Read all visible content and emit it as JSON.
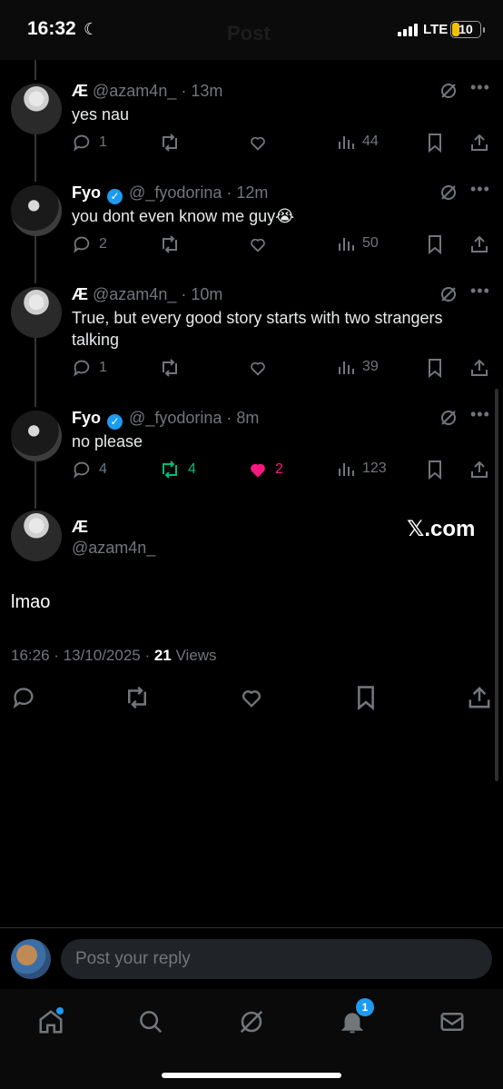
{
  "status_bar": {
    "time": "16:32",
    "network": "LTE",
    "battery": "10"
  },
  "header": {
    "title": "Post"
  },
  "replies": [
    {
      "name": "Æ",
      "verified": false,
      "handle": "@azam4n_",
      "time": "13m",
      "text": "yes nau",
      "replies": "1",
      "reposts": "",
      "likes": "",
      "views": "44",
      "avatar": "ae"
    },
    {
      "name": "Fyo",
      "verified": true,
      "handle": "@_fyodorina",
      "time": "12m",
      "text": "you dont even know me guy😭",
      "replies": "2",
      "reposts": "",
      "likes": "",
      "views": "50",
      "avatar": "fyo"
    },
    {
      "name": "Æ",
      "verified": false,
      "handle": "@azam4n_",
      "time": "10m",
      "text": "True, but every good story starts with two strangers talking",
      "replies": "1",
      "reposts": "",
      "likes": "",
      "views": "39",
      "avatar": "ae"
    },
    {
      "name": "Fyo",
      "verified": true,
      "handle": "@_fyodorina",
      "time": "8m",
      "text": "no please",
      "replies": "4",
      "reposts": "4",
      "likes": "2",
      "views": "123",
      "avatar": "fyo",
      "reposted": true,
      "liked": true
    }
  ],
  "main_post": {
    "name": "Æ",
    "handle": "@azam4n_",
    "watermark": "𝕏.com",
    "text": "lmao",
    "timestamp": "16:26 · 13/10/2025 · ",
    "views_count": "21",
    "views_label": " Views"
  },
  "reply_bar": {
    "placeholder": "Post your reply"
  },
  "bottom_nav": {
    "notifications_badge": "1"
  },
  "colors": {
    "accent": "#1d9bf0",
    "repost_active": "#00ba7c",
    "like_active": "#f91880",
    "muted": "#71767b"
  }
}
